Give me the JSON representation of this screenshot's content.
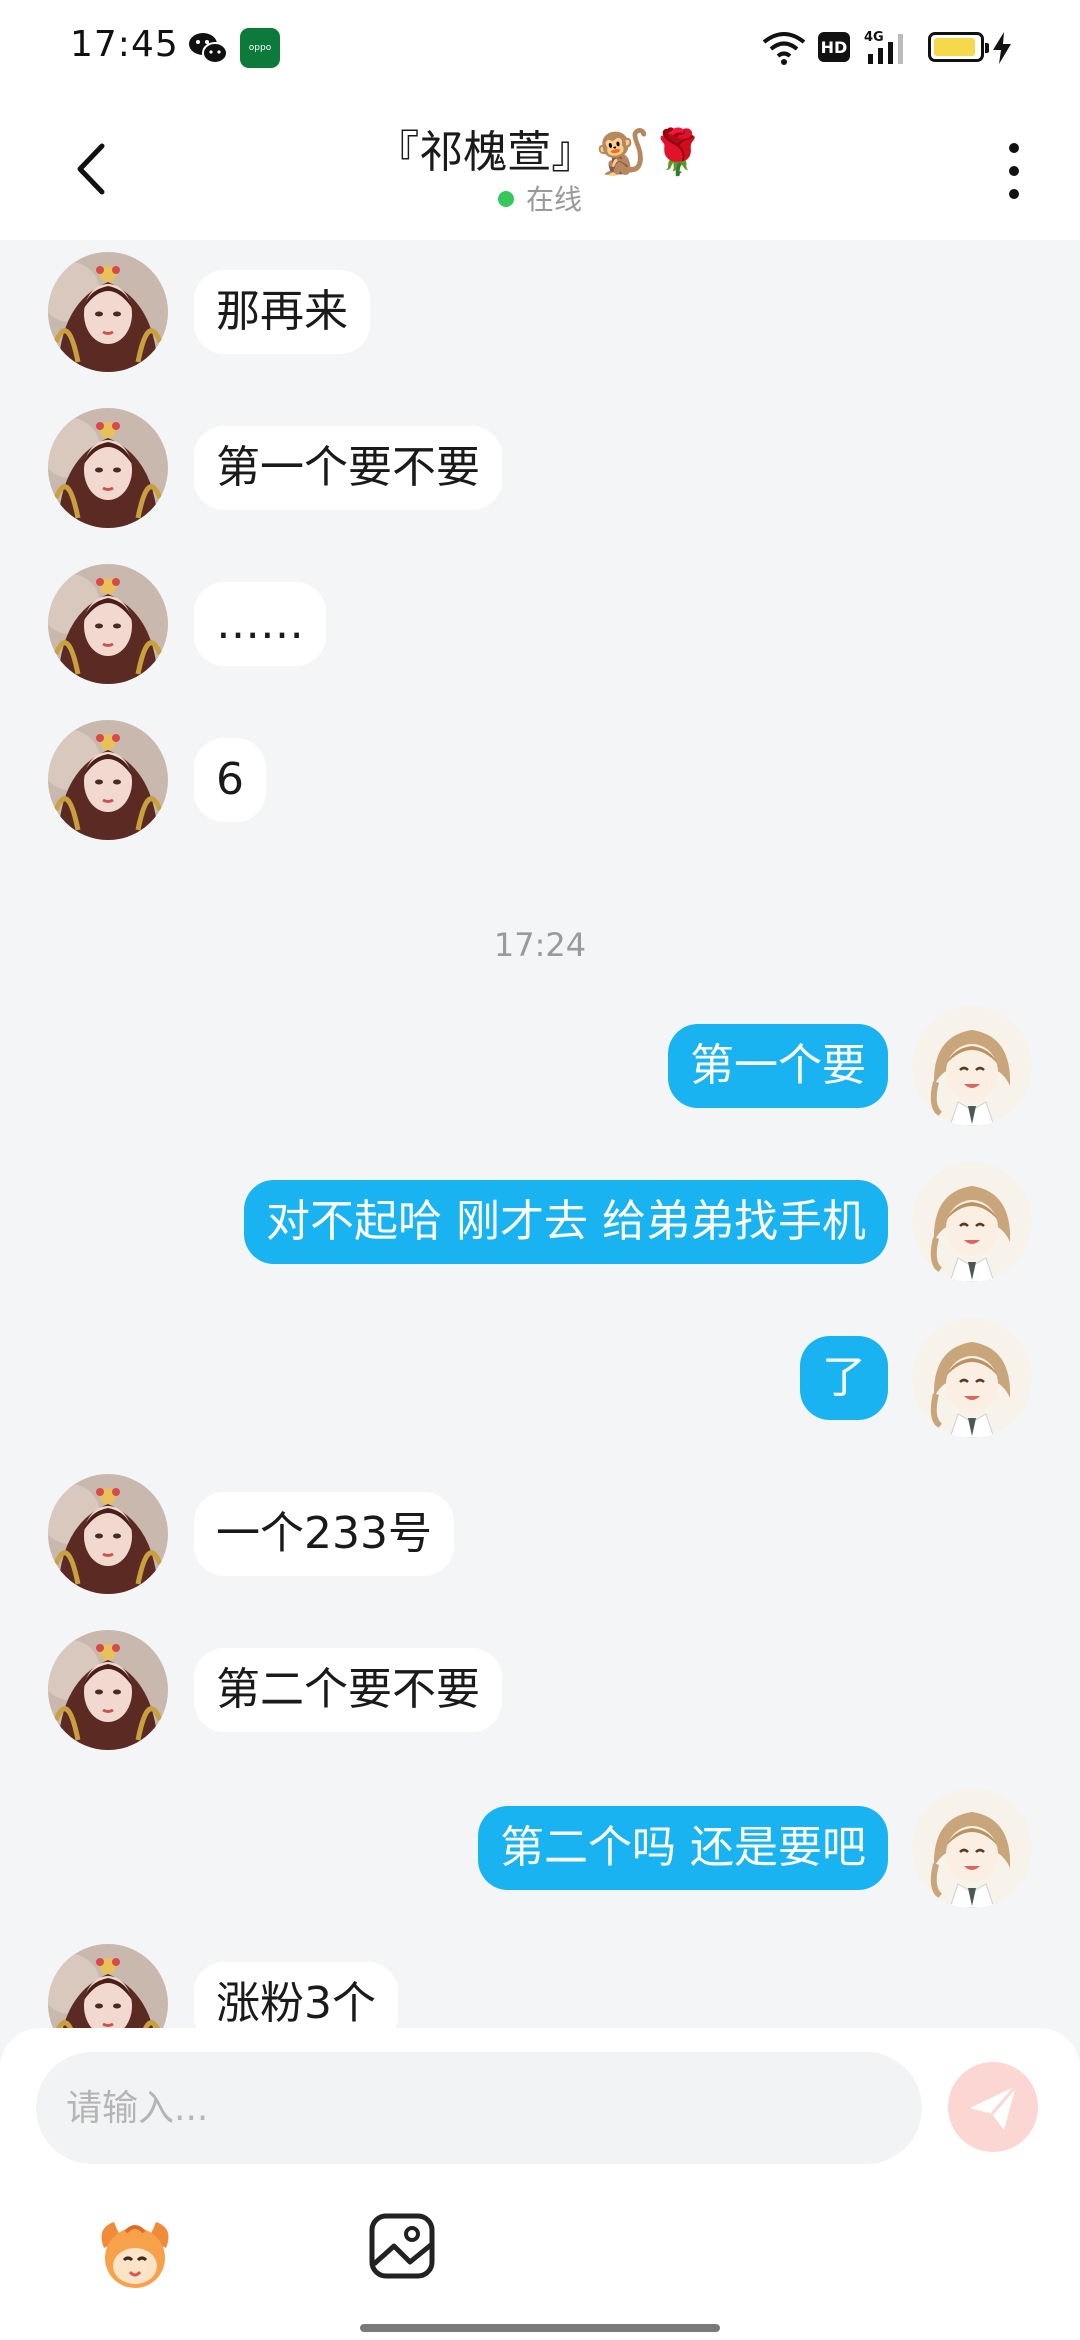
{
  "status_bar": {
    "time": "17:45",
    "network": "4G",
    "hd": "HD"
  },
  "header": {
    "title": "『祁槐萱』🐒🌹",
    "status": "在线",
    "online_color": "#35c759"
  },
  "messages": [
    {
      "side": "left",
      "text": "那再来"
    },
    {
      "side": "left",
      "text": "第一个要不要"
    },
    {
      "side": "left",
      "text": "……"
    },
    {
      "side": "left",
      "text": "6"
    },
    {
      "side": "right",
      "text": "第一个要"
    },
    {
      "side": "right",
      "text": "对不起哈 刚才去 给弟弟找手机"
    },
    {
      "side": "right",
      "text": "了"
    },
    {
      "side": "left",
      "text": "一个233号"
    },
    {
      "side": "left",
      "text": "第二个要不要"
    },
    {
      "side": "right",
      "text": "第二个吗 还是要吧"
    },
    {
      "side": "left",
      "text": "涨粉3个"
    }
  ],
  "timestamp": "17:24",
  "input": {
    "placeholder": "请输入..."
  },
  "colors": {
    "outgoing_bubble": "#19b3f2",
    "incoming_bubble": "#ffffff",
    "send_button": "#fcd6d2"
  },
  "icons": {
    "back": "chevron-left-icon",
    "more": "more-vertical-icon",
    "send": "paper-plane-icon",
    "sticker": "sticker-icon",
    "image": "image-icon"
  }
}
